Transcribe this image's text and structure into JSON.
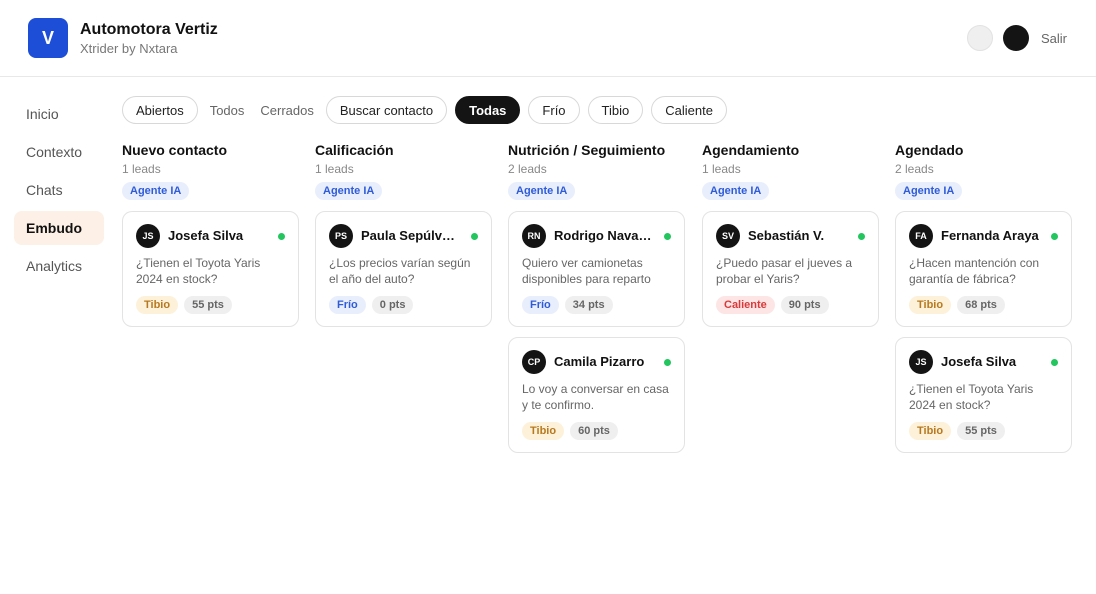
{
  "app": {
    "logo_letter": "V",
    "title": "Automotora Vertiz",
    "subtitle": "Xtrider by Nxtara",
    "logout_label": "Salir"
  },
  "sidebar": {
    "items": [
      {
        "label": "Inicio",
        "active": false
      },
      {
        "label": "Contexto",
        "active": false
      },
      {
        "label": "Chats",
        "active": false
      },
      {
        "label": "Embudo",
        "active": true
      },
      {
        "label": "Analytics",
        "active": false
      }
    ]
  },
  "filters": {
    "status": [
      "Abiertos",
      "Todos",
      "Cerrados"
    ],
    "search_label": "Buscar contacto",
    "temperature": [
      "Todas",
      "Frío",
      "Tibio",
      "Caliente"
    ],
    "selected_status": "Abiertos",
    "selected_temperature": "Todas"
  },
  "columns": [
    {
      "title": "Nuevo contacto",
      "count": "1 leads",
      "agent_label": "Agente IA",
      "cards": [
        {
          "initials": "JS",
          "name": "Josefa Silva",
          "message": "¿Tienen el Toyota Yaris 2024 en stock?",
          "temp": "Tibio",
          "temp_class": "tibio",
          "points": "55 pts"
        }
      ]
    },
    {
      "title": "Calificación",
      "count": "1 leads",
      "agent_label": "Agente IA",
      "cards": [
        {
          "initials": "PS",
          "name": "Paula Sepúlveda",
          "message": "¿Los precios varían según el año del auto?",
          "temp": "Frío",
          "temp_class": "frio",
          "points": "0 pts"
        }
      ]
    },
    {
      "title": "Nutrición / Seguimiento",
      "count": "2 leads",
      "agent_label": "Agente IA",
      "cards": [
        {
          "initials": "RN",
          "name": "Rodrigo Navarro",
          "message": "Quiero ver camionetas disponibles para reparto",
          "temp": "Frío",
          "temp_class": "frio",
          "points": "34 pts"
        },
        {
          "initials": "CP",
          "name": "Camila Pizarro",
          "message": "Lo voy a conversar en casa y te confirmo.",
          "temp": "Tibio",
          "temp_class": "tibio",
          "points": "60 pts"
        }
      ]
    },
    {
      "title": "Agendamiento",
      "count": "1 leads",
      "agent_label": "Agente IA",
      "cards": [
        {
          "initials": "SV",
          "name": "Sebastián V.",
          "message": "¿Puedo pasar el jueves a probar el Yaris?",
          "temp": "Caliente",
          "temp_class": "caliente",
          "points": "90 pts"
        }
      ]
    },
    {
      "title": "Agendado",
      "count": "2 leads",
      "agent_label": "Agente IA",
      "cards": [
        {
          "initials": "FA",
          "name": "Fernanda Araya",
          "message": "¿Hacen mantención con garantía de fábrica?",
          "temp": "Tibio",
          "temp_class": "tibio",
          "points": "68 pts"
        },
        {
          "initials": "JS",
          "name": "Josefa Silva",
          "message": "¿Tienen el Toyota Yaris 2024 en stock?",
          "temp": "Tibio",
          "temp_class": "tibio",
          "points": "55 pts"
        }
      ]
    }
  ]
}
